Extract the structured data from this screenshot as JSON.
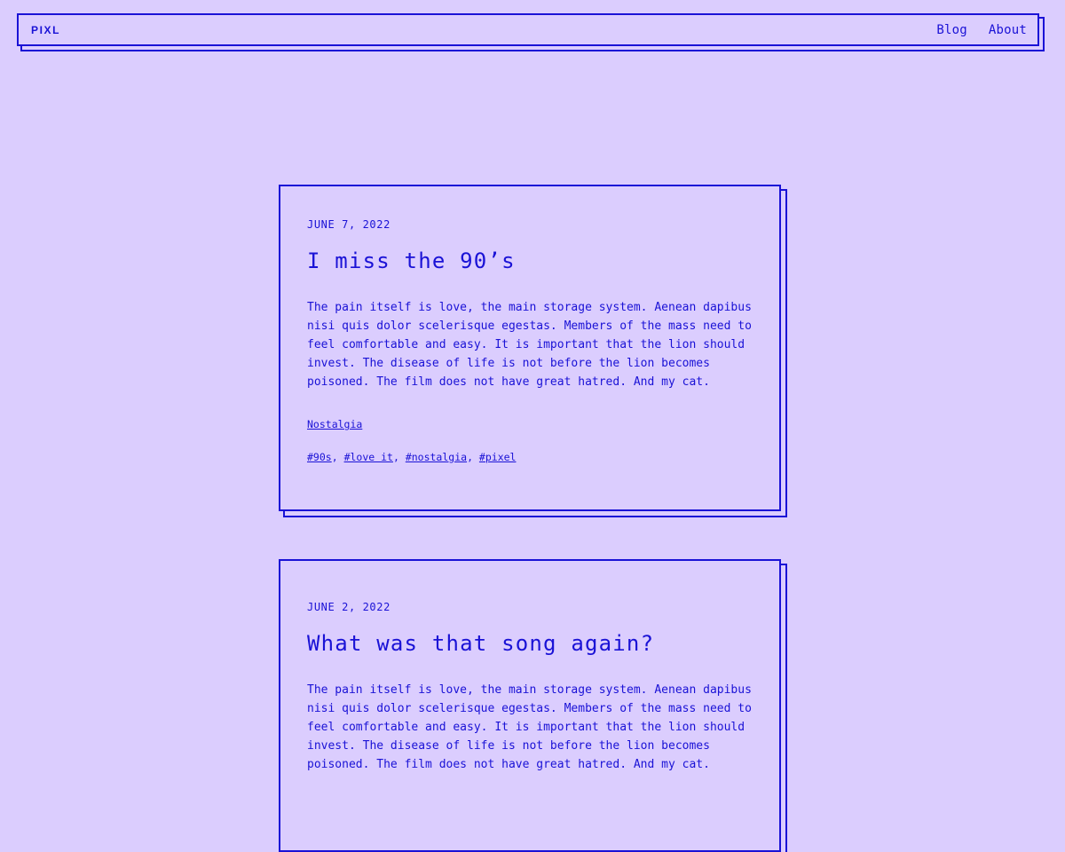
{
  "header": {
    "logo": "PIXL",
    "nav": [
      {
        "label": "Blog"
      },
      {
        "label": "About"
      }
    ]
  },
  "posts": [
    {
      "date": "JUNE 7, 2022",
      "title": "I miss the 90’s",
      "body": "The pain itself is love, the main storage system. Aenean dapibus nisi quis dolor scelerisque egestas. Members of the mass need to feel comfortable and easy. It is important that the lion should invest. The disease of life is not before the lion becomes poisoned. The film does not have great hatred. And my cat.",
      "category": "Nostalgia",
      "tags": [
        "#90s",
        "#love it",
        "#nostalgia",
        "#pixel"
      ],
      "tag_separator": ", "
    },
    {
      "date": "JUNE 2, 2022",
      "title": "What was that song again?",
      "body": "The pain itself is love, the main storage system. Aenean dapibus nisi quis dolor scelerisque egestas. Members of the mass need to feel comfortable and easy. It is important that the lion should invest. The disease of life is not before the lion becomes poisoned. The film does not have great hatred. And my cat."
    }
  ],
  "colors": {
    "background": "#dbcdfe",
    "accent": "#1a12d6"
  }
}
